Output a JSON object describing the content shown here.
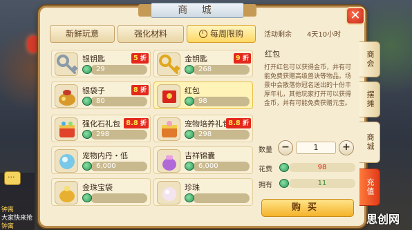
{
  "window": {
    "title": "商 城",
    "close_label": "✕"
  },
  "tabs": [
    {
      "label": "新鲜玩意",
      "active": false
    },
    {
      "label": "强化材料",
      "active": false
    },
    {
      "label": "每周限购",
      "active": true
    }
  ],
  "remaining": {
    "label": "活动剩余",
    "value": "4天10小时"
  },
  "items": [
    {
      "name": "银钥匙",
      "price": "29",
      "discount": "5",
      "discount_suffix": "折",
      "icon": "silver-key-icon"
    },
    {
      "name": "金钥匙",
      "price": "268",
      "discount": "9",
      "discount_suffix": "折",
      "icon": "gold-key-icon"
    },
    {
      "name": "银袋子",
      "price": "80",
      "discount": "8",
      "discount_suffix": "折",
      "icon": "silver-bag-icon"
    },
    {
      "name": "红包",
      "price": "98",
      "discount": "",
      "discount_suffix": "",
      "icon": "red-envelope-icon",
      "selected": true
    },
    {
      "name": "强化石礼包",
      "price": "298",
      "discount": "8.8",
      "discount_suffix": "折",
      "icon": "enhance-stone-pack-icon"
    },
    {
      "name": "宠物培养礼包",
      "price": "298",
      "discount": "8.8",
      "discount_suffix": "折",
      "icon": "pet-training-pack-icon"
    },
    {
      "name": "宠物内丹・低",
      "price": "6,000",
      "discount": "",
      "discount_suffix": "",
      "icon": "pet-core-icon"
    },
    {
      "name": "吉祥锦囊",
      "price": "6,000",
      "discount": "",
      "discount_suffix": "",
      "icon": "lucky-pouch-icon"
    },
    {
      "name": "金珠宝袋",
      "price": "",
      "discount": "",
      "discount_suffix": "",
      "icon": "gold-pearl-bag-icon"
    },
    {
      "name": "珍珠",
      "price": "",
      "discount": "",
      "discount_suffix": "",
      "icon": "pearl-icon"
    }
  ],
  "detail": {
    "title": "红包",
    "description": "打开红包可以获得金币，并有可能免费获赠高级兽诀等物品。场景中会散落你冠名送出的十份丰厚年礼，其他玩家打开可以获得金币，并有可能免费获赠元宝。",
    "quantity_label": "数量",
    "quantity_value": "1",
    "minus_label": "−",
    "plus_label": "+",
    "cost_label": "花费",
    "cost_value": "98",
    "own_label": "拥有",
    "own_value": "11",
    "buy_label": "购买"
  },
  "side_tabs": [
    {
      "label": "商会",
      "active": false
    },
    {
      "label": "摆摊",
      "active": false
    },
    {
      "label": "商城",
      "active": true
    },
    {
      "label": "充值",
      "active": false,
      "style": "recharge"
    }
  ],
  "background": {
    "chat_lines": [
      "钟离",
      "大家快来抢",
      "钟离"
    ]
  },
  "colors": {
    "panel": "#f6ecd2",
    "discount_badge": "#e3281c",
    "cost_text": "#e3281c",
    "own_text": "#3a8a3a",
    "buy_button": "#f4b32a"
  },
  "watermark": "思创网"
}
